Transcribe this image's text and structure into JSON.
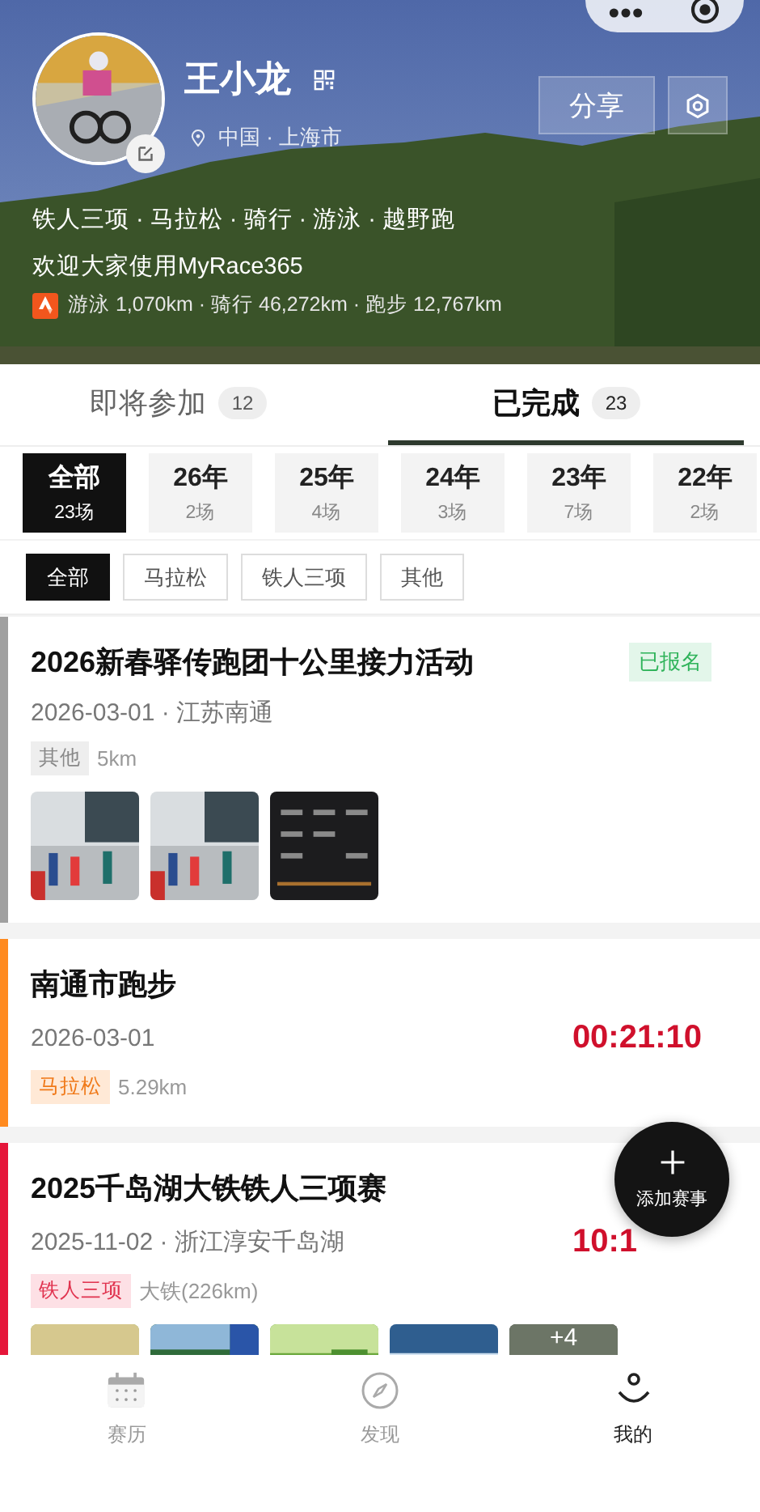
{
  "header": {
    "name": "王小龙",
    "location": "中国 · 上海市",
    "share_label": "分享",
    "sports": "铁人三项 · 马拉松 · 骑行 · 游泳 · 越野跑",
    "bio": "欢迎大家使用MyRace365",
    "stats": "游泳 1,070km · 骑行 46,272km · 跑步 12,767km"
  },
  "tabs": [
    {
      "label": "即将参加",
      "count": "12",
      "selected": false
    },
    {
      "label": "已完成",
      "count": "23",
      "selected": true
    }
  ],
  "years": [
    {
      "label": "全部",
      "count": "23场",
      "selected": true
    },
    {
      "label": "26年",
      "count": "2场",
      "selected": false
    },
    {
      "label": "25年",
      "count": "4场",
      "selected": false
    },
    {
      "label": "24年",
      "count": "3场",
      "selected": false
    },
    {
      "label": "23年",
      "count": "7场",
      "selected": false
    },
    {
      "label": "22年",
      "count": "2场",
      "selected": false
    }
  ],
  "filters": [
    {
      "label": "全部",
      "selected": true
    },
    {
      "label": "马拉松",
      "selected": false
    },
    {
      "label": "铁人三项",
      "selected": false
    },
    {
      "label": "其他",
      "selected": false
    }
  ],
  "races": [
    {
      "kind": "other",
      "title": "2026新春驿传跑团十公里接力活动",
      "date": "2026-03-01 · 江苏南通",
      "tag": "其他",
      "distance": "5km",
      "status": "已报名"
    },
    {
      "kind": "marathon",
      "title": "南通市跑步",
      "date": "2026-03-01",
      "tag": "马拉松",
      "distance": "5.29km",
      "time": "00:21:10"
    },
    {
      "kind": "triathlon",
      "title": "2025千岛湖大铁铁人三项赛",
      "date": "2025-11-02 · 浙江淳安千岛湖",
      "tag": "铁人三项",
      "distance": "大铁(226km)",
      "time": "10:1",
      "more_count": "+4"
    }
  ],
  "fab": {
    "label": "添加赛事"
  },
  "nav": [
    {
      "label": "赛历",
      "selected": false
    },
    {
      "label": "发现",
      "selected": false
    },
    {
      "label": "我的",
      "selected": true
    }
  ]
}
